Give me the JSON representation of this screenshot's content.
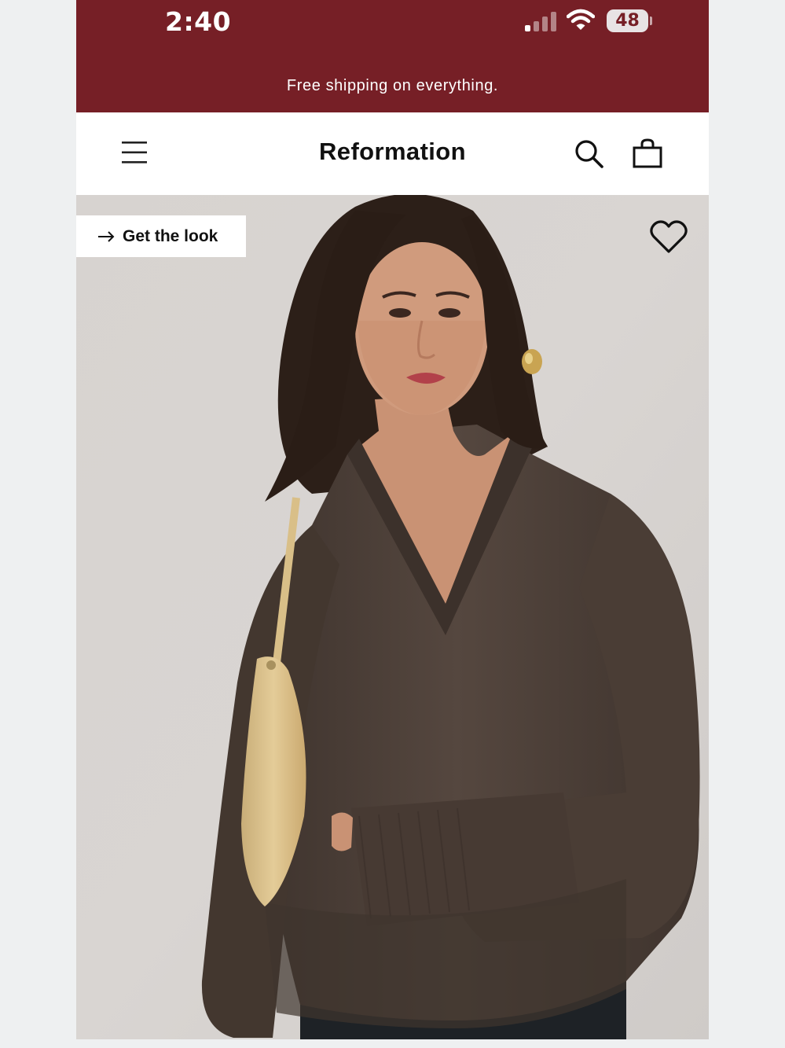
{
  "status_bar": {
    "time": "2:40",
    "battery_level": "48",
    "signal_bars_active": 1,
    "signal_bars_total": 4,
    "wifi_icon": "wifi-icon"
  },
  "promo_banner": {
    "text": "Free shipping on everything."
  },
  "header": {
    "brand": "Reformation",
    "menu_icon": "hamburger-menu-icon",
    "search_icon": "search-icon",
    "bag_icon": "shopping-bag-icon"
  },
  "hero": {
    "cta_label": "Get the look",
    "cta_icon": "arrow-right-icon",
    "favorite_icon": "heart-icon"
  },
  "colors": {
    "banner": "#761f26",
    "nav_background": "#ffffff",
    "text_dark": "#111111",
    "photo_backdrop": "#d9d5d2",
    "sweater": "#4d4038",
    "bag": "#e1c892"
  }
}
